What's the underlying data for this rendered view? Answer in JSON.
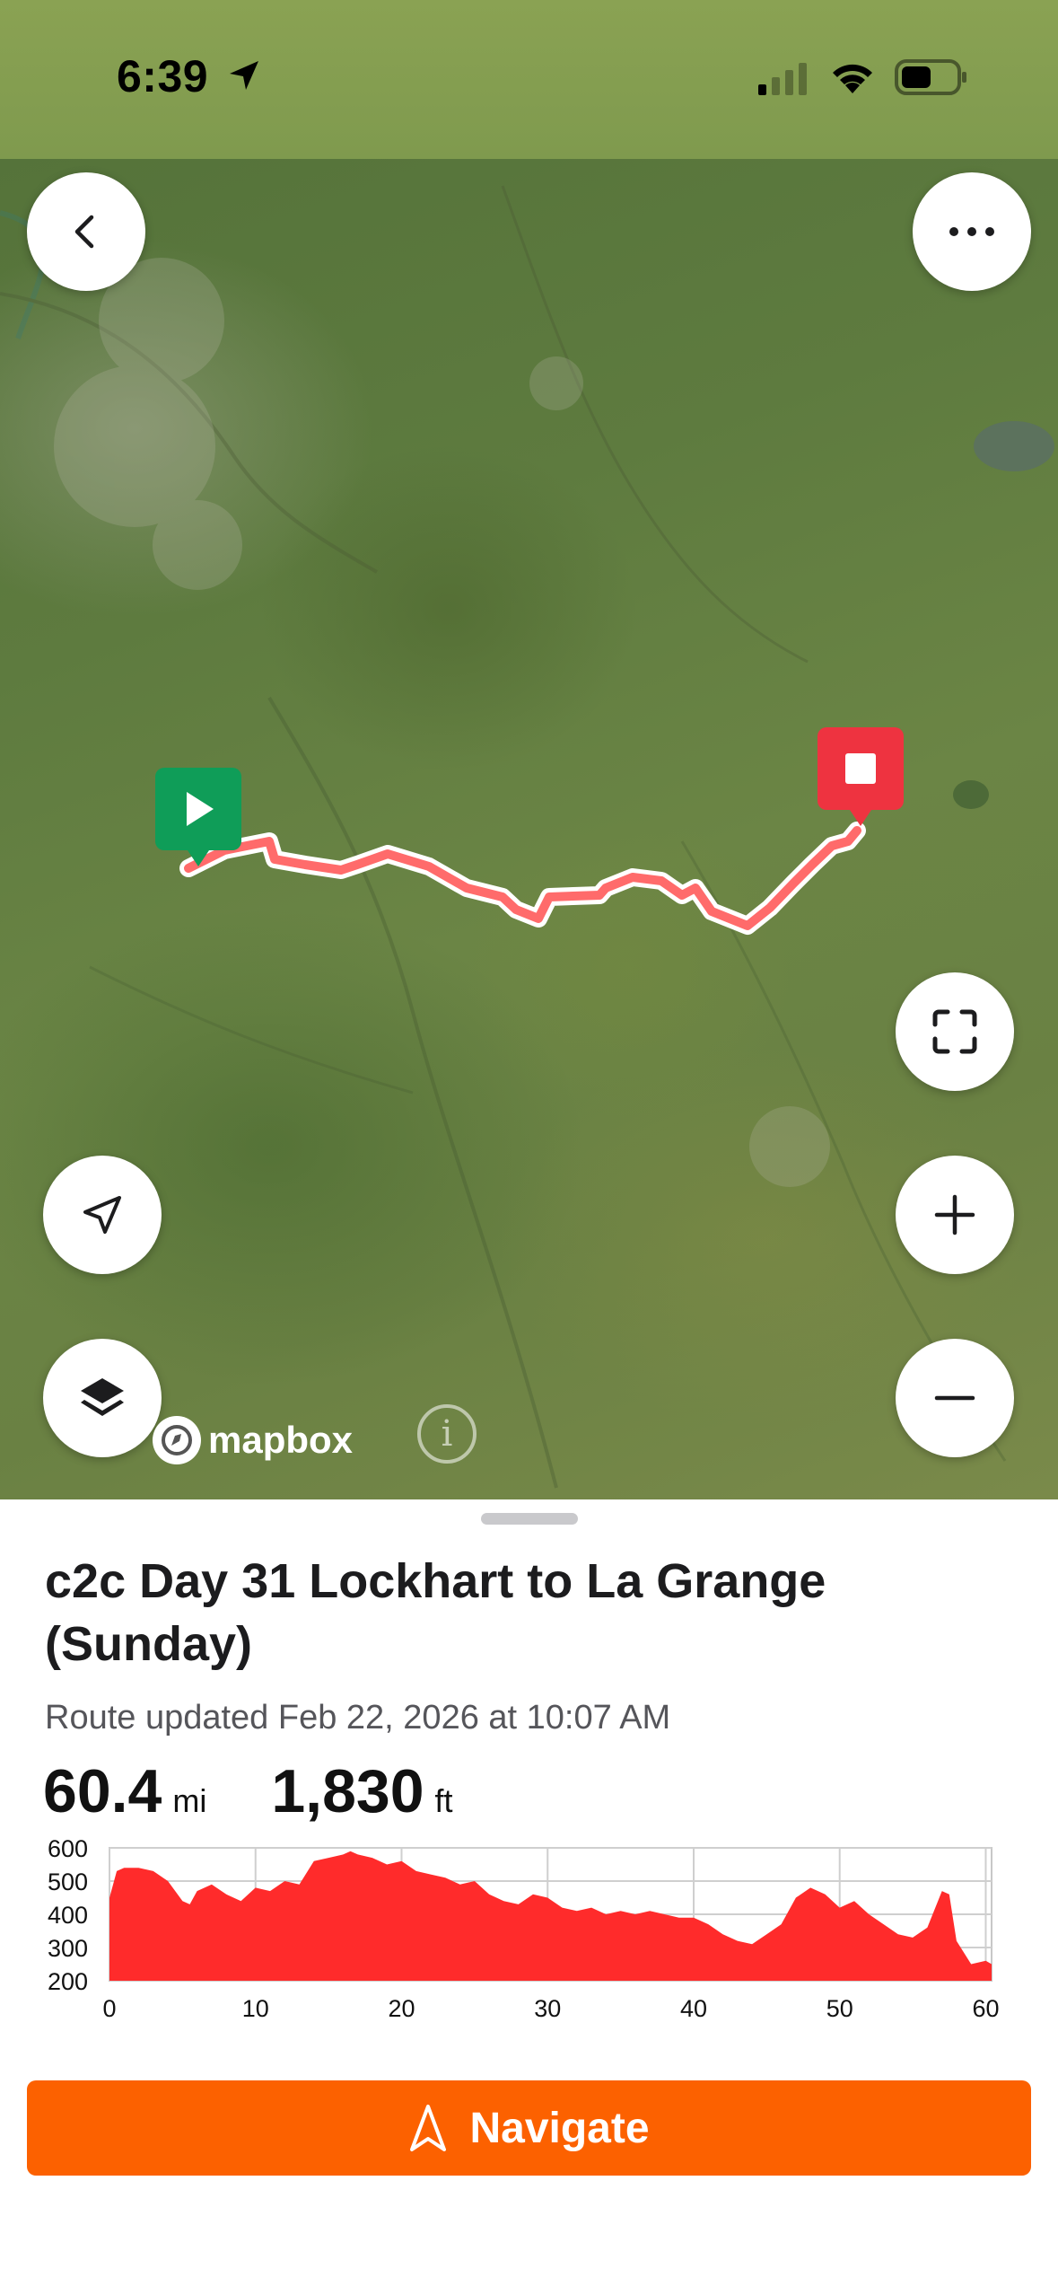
{
  "status_bar": {
    "time": "6:39"
  },
  "map": {
    "attribution": "mapbox",
    "info_glyph": "i",
    "buttons": {
      "back": "back-icon",
      "more": "more-icon",
      "fullscreen": "fullscreen-icon",
      "locate": "locate-arrow-icon",
      "zoom_in": "plus-icon",
      "layers": "layers-icon",
      "zoom_out": "minus-icon"
    },
    "route_color": "#ff6b6b",
    "start_pin_color": "#0f9d58",
    "end_pin_color": "#ee3340"
  },
  "route": {
    "title": "c2c Day 31 Lockhart to La Grange (Sunday)",
    "updated": "Route updated Feb 22, 2026 at 10:07 AM",
    "distance_value": "60.4",
    "distance_unit": "mi",
    "elevation_value": "1,830",
    "elevation_unit": "ft"
  },
  "chart_data": {
    "type": "area",
    "xlabel": "",
    "ylabel": "",
    "x_ticks": [
      "0",
      "10",
      "20",
      "30",
      "40",
      "50",
      "60"
    ],
    "y_ticks": [
      "600",
      "500",
      "400",
      "300",
      "200"
    ],
    "xlim": [
      0,
      60.4
    ],
    "ylim": [
      200,
      600
    ],
    "grid": true,
    "fill_color": "#ff2b2b",
    "series": [
      {
        "x": [
          0,
          0.5,
          1,
          2,
          3,
          4,
          5,
          5.5,
          6,
          7,
          8,
          9,
          10,
          11,
          12,
          13,
          14,
          15,
          16,
          16.5,
          17,
          18,
          19,
          20,
          21,
          22,
          23,
          24,
          25,
          26,
          27,
          28,
          29,
          30,
          31,
          32,
          33,
          34,
          35,
          36,
          37,
          38,
          39,
          40,
          41,
          42,
          43,
          44,
          45,
          46,
          47,
          48,
          49,
          50,
          51,
          52,
          53,
          54,
          55,
          56,
          57,
          57.5,
          58,
          59,
          60,
          60.4
        ],
        "y": [
          450,
          530,
          540,
          540,
          530,
          500,
          440,
          430,
          470,
          490,
          460,
          440,
          480,
          470,
          500,
          490,
          560,
          570,
          580,
          590,
          580,
          570,
          550,
          560,
          530,
          520,
          510,
          490,
          500,
          460,
          440,
          430,
          460,
          450,
          420,
          410,
          420,
          400,
          410,
          400,
          410,
          400,
          390,
          390,
          370,
          340,
          320,
          310,
          340,
          370,
          450,
          480,
          460,
          420,
          440,
          400,
          370,
          340,
          330,
          360,
          470,
          460,
          320,
          250,
          260,
          250
        ]
      }
    ]
  },
  "navigate": {
    "label": "Navigate",
    "color": "#fc6100"
  }
}
